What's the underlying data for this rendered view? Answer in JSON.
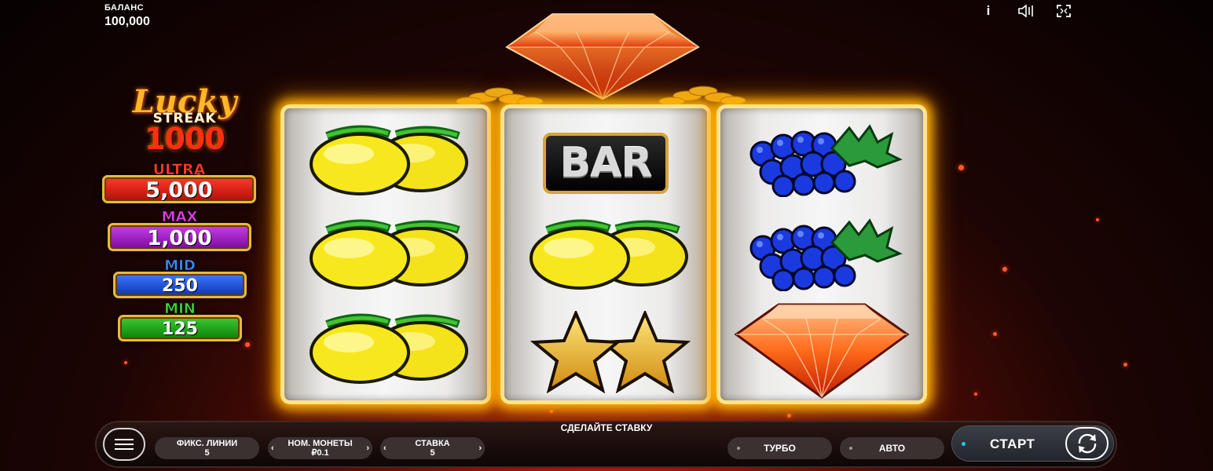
{
  "balance": {
    "label": "БАЛАНС",
    "value": "100,000"
  },
  "top_icons": [
    "info-icon",
    "sound-icon",
    "fullscreen-icon"
  ],
  "top_icon_glyphs": {
    "info": "i"
  },
  "logo": {
    "line1": "Lucky",
    "line2": "STREAK",
    "line3": "1000"
  },
  "jackpots": [
    {
      "name": "ULTRA",
      "value": "5,000",
      "name_color": "#ff3a2a",
      "box_color": "#d11a12"
    },
    {
      "name": "MAX",
      "value": "1,000",
      "name_color": "#e63cf0",
      "box_color": "#9a1ac0"
    },
    {
      "name": "MID",
      "value": "250",
      "name_color": "#3a8cff",
      "box_color": "#1a4ee0"
    },
    {
      "name": "MIN",
      "value": "125",
      "name_color": "#3cd23a",
      "box_color": "#1a9a14"
    }
  ],
  "reels": [
    [
      "lemon",
      "lemon",
      "lemon"
    ],
    [
      "bar",
      "lemon",
      "star"
    ],
    [
      "grapes",
      "grapes",
      "diamond"
    ]
  ],
  "symbol_text": {
    "bar": "BAR"
  },
  "controls": {
    "prompt": "СДЕЛАЙТЕ СТАВКУ",
    "lines": {
      "label": "ФИКС. ЛИНИИ",
      "value": "5"
    },
    "coin": {
      "label": "НОМ. МОНЕТЫ",
      "value": "₽0.1"
    },
    "bet": {
      "label": "СТАВКА",
      "value": "5"
    },
    "turbo": "ТУРБО",
    "auto": "АВТО",
    "start": "СТАРТ",
    "arrow_left": "‹",
    "arrow_right": "›"
  },
  "colors": {
    "reel_glow": "#ffb400",
    "accent_dot": "#2ec4e8"
  }
}
